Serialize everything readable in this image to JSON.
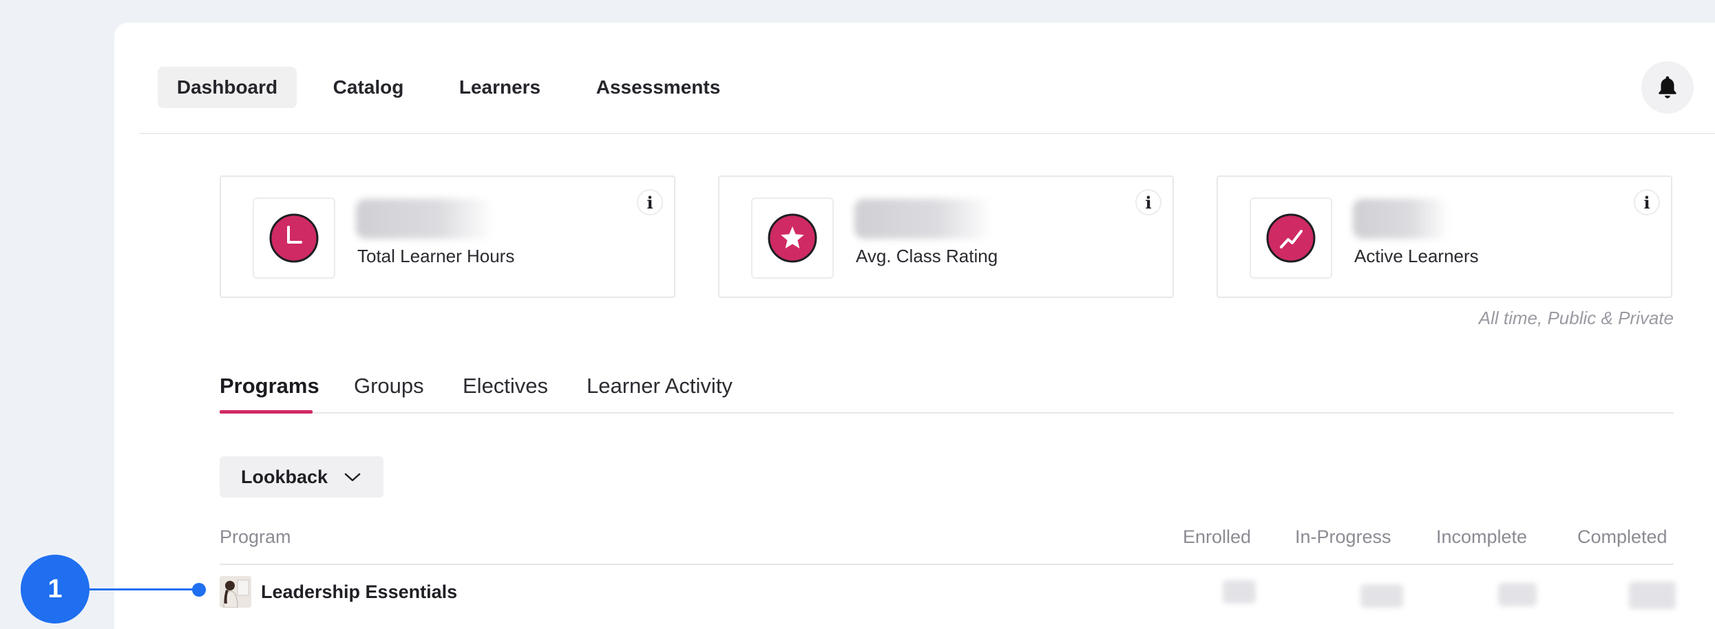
{
  "topnav": {
    "tabs": [
      "Dashboard",
      "Catalog",
      "Learners",
      "Assessments"
    ],
    "active_tab": "Dashboard",
    "notifications_icon": "bell-icon"
  },
  "stats": [
    {
      "label": "Total Learner Hours",
      "value": "",
      "icon": "clock-icon"
    },
    {
      "label": "Avg. Class Rating",
      "value": "",
      "icon": "star-icon"
    },
    {
      "label": "Active Learners",
      "value": "",
      "icon": "trend-up-icon"
    }
  ],
  "stats_scope": "All time, Public & Private",
  "section_tabs": [
    "Programs",
    "Groups",
    "Electives",
    "Learner Activity"
  ],
  "active_section_tab": "Programs",
  "filter": {
    "label": "Lookback"
  },
  "table": {
    "headers": [
      "Program",
      "Enrolled",
      "In-Progress",
      "Incomplete",
      "Completed"
    ],
    "rows": [
      {
        "title": "Leadership Essentials",
        "enrolled": "",
        "in_progress": "",
        "incomplete": "",
        "completed": ""
      }
    ]
  },
  "annotation": {
    "number": "1"
  },
  "colors": {
    "accent": "#cf2a64",
    "callout": "#1f6ff0",
    "page_bg": "#eef2f7"
  }
}
